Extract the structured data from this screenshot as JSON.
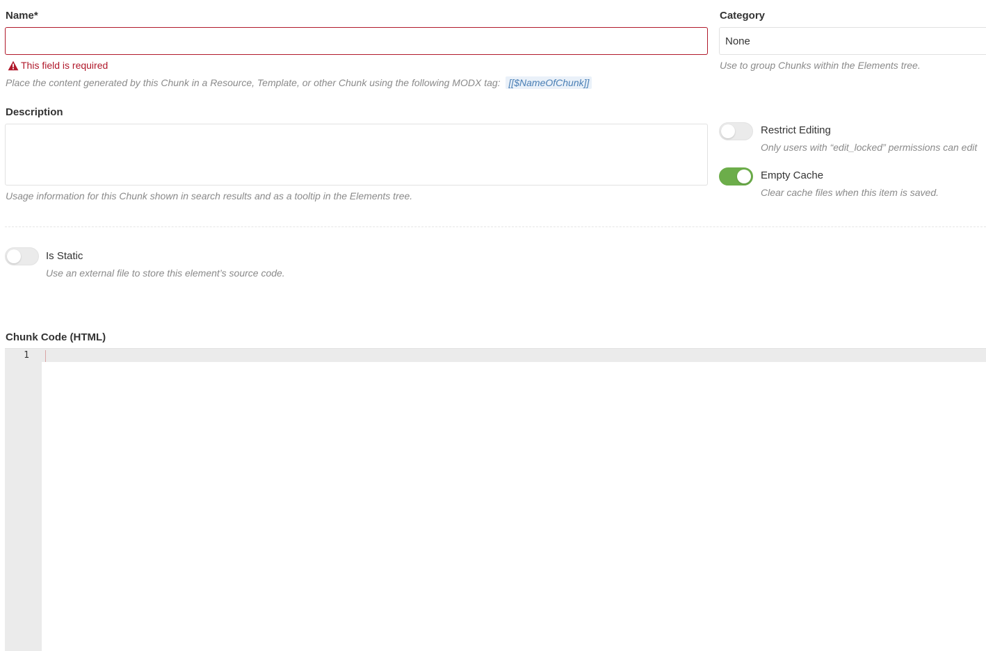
{
  "name_field": {
    "label": "Name*",
    "value": "",
    "placeholder": "",
    "error": "This field is required",
    "help_prefix": "Place the content generated by this Chunk in a Resource, Template, or other Chunk using the following MODX tag:",
    "help_tag": "[[$NameOfChunk]]"
  },
  "description_field": {
    "label": "Description",
    "value": "",
    "help": "Usage information for this Chunk shown in search results and as a tooltip in the Elements tree."
  },
  "category_field": {
    "label": "Category",
    "value": "None",
    "help": "Use to group Chunks within the Elements tree."
  },
  "toggles": {
    "restrict_editing": {
      "label": "Restrict Editing",
      "help": "Only users with “edit_locked” permissions can edit",
      "checked": false
    },
    "empty_cache": {
      "label": "Empty Cache",
      "help": "Clear cache files when this item is saved.",
      "checked": true
    },
    "is_static": {
      "label": "Is Static",
      "help": "Use an external file to store this element’s source code.",
      "checked": false
    }
  },
  "code_editor": {
    "label": "Chunk Code (HTML)",
    "line_numbers": [
      "1"
    ],
    "content": ""
  },
  "colors": {
    "error": "#b0182a",
    "toggle_on": "#6cad4a",
    "toggle_off": "#ebebeb",
    "tag_text": "#4a7fb5"
  },
  "icons": {
    "error_icon": "warning-triangle"
  }
}
